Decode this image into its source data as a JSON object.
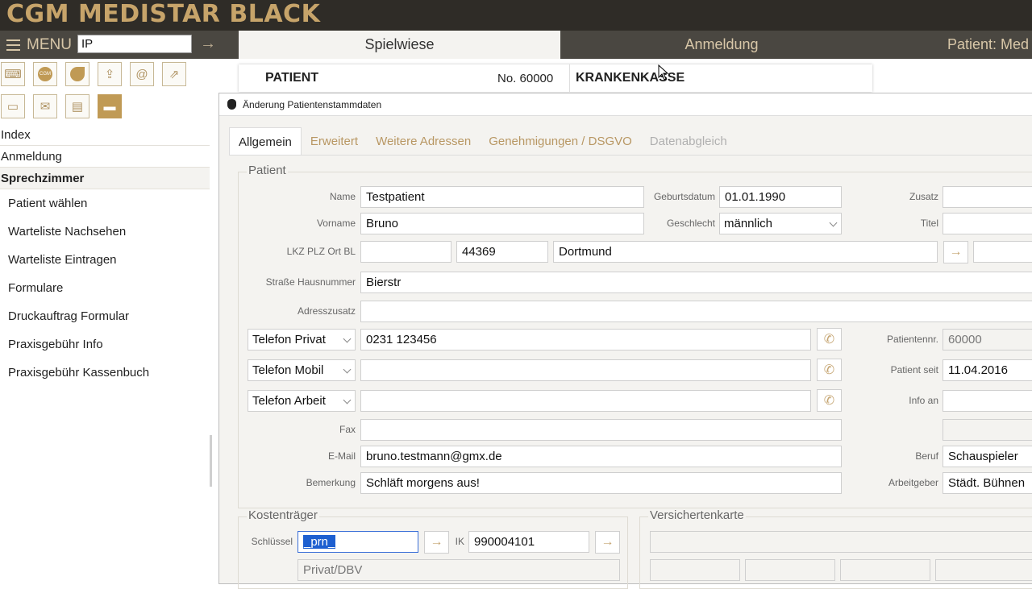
{
  "app": {
    "title": "CGM MEDISTAR BLACK"
  },
  "nav": {
    "menu_label": "MENU",
    "search_value": "IP",
    "tabs": [
      {
        "label": "Spielwiese"
      },
      {
        "label": "Anmeldung"
      },
      {
        "label": "Patient: Med"
      }
    ]
  },
  "toolbar_icons": [
    "keyboard-icon",
    "cgm-logo-icon",
    "leaf-icon",
    "upload-icon",
    "at-sign-icon",
    "import-icon",
    "video-icon",
    "mail-icon",
    "clipboard-icon",
    "chat-icon"
  ],
  "sidebar": {
    "headers": [
      "Index",
      "Anmeldung",
      "Sprechzimmer"
    ],
    "items": [
      "Patient wählen",
      "Warteliste Nachsehen",
      "Warteliste Eintragen",
      "Formulare",
      "Druckauftrag Formular",
      "Praxisgebühr Info",
      "Praxisgebühr Kassenbuch"
    ]
  },
  "patient_header": {
    "label": "PATIENT",
    "number": "No. 60000",
    "insurance_label": "KRANKENKASSE"
  },
  "dialog": {
    "title": "Änderung Patientenstammdaten",
    "tabs": [
      {
        "label": "Allgemein"
      },
      {
        "label": "Erweitert"
      },
      {
        "label": "Weitere Adressen"
      },
      {
        "label": "Genehmigungen / DSGVO"
      },
      {
        "label": "Datenabgleich"
      }
    ],
    "patient_group": {
      "title": "Patient",
      "name_label": "Name",
      "name": "Testpatient",
      "vorname_label": "Vorname",
      "vorname": "Bruno",
      "lkz_label": "LKZ PLZ Ort BL",
      "lkz": "",
      "plz": "44369",
      "ort": "Dortmund",
      "strasse_label": "Straße Hausnummer",
      "strasse": "Bierstr",
      "adresszusatz_label": "Adresszusatz",
      "adresszusatz": "",
      "geburtsdatum_label": "Geburtsdatum",
      "geburtsdatum": "01.01.1990",
      "geschlecht_label": "Geschlecht",
      "geschlecht": "männlich",
      "zusatz_label": "Zusatz",
      "titel_label": "Titel",
      "phone1_type": "Telefon Privat",
      "phone1": "0231 123456",
      "phone2_type": "Telefon Mobil",
      "phone2": "",
      "phone3_type": "Telefon Arbeit",
      "phone3": "",
      "fax_label": "Fax",
      "fax": "",
      "email_label": "E-Mail",
      "email": "bruno.testmann@gmx.de",
      "bemerkung_label": "Bemerkung",
      "bemerkung": "Schläft morgens aus!",
      "patientennr_label": "Patientennr.",
      "patientennr": "60000",
      "patient_seit_label": "Patient seit",
      "patient_seit": "11.04.2016",
      "info_an_label": "Info an",
      "beruf_label": "Beruf",
      "beruf": "Schauspieler",
      "arbeitgeber_label": "Arbeitgeber",
      "arbeitgeber": "Städt. Bühnen"
    },
    "kostentraeger": {
      "title": "Kostenträger",
      "schluessel_label": "Schlüssel",
      "schluessel": "_prn_",
      "ik_label": "IK",
      "ik": "990004101",
      "type_value": "Privat/DBV"
    },
    "versichertenkarte": {
      "title": "Versichertenkarte"
    }
  },
  "colors": {
    "accent": "#c7a46a",
    "banner_bg": "#2f2c27",
    "nav_bg": "#4a4741",
    "selection": "#1d5fd0"
  }
}
